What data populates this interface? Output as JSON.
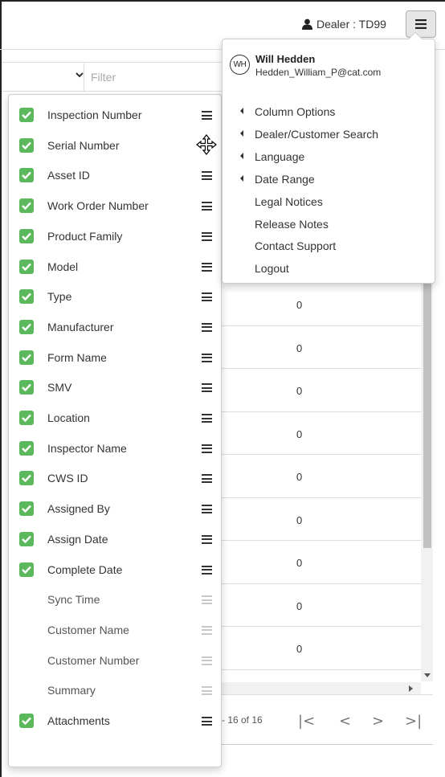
{
  "header": {
    "dealer_label": "Dealer : TD99"
  },
  "filter": {
    "placeholder": "Filter"
  },
  "columns": [
    {
      "label": "Inspection Number",
      "checked": true
    },
    {
      "label": "Serial Number",
      "checked": true
    },
    {
      "label": "Asset ID",
      "checked": true
    },
    {
      "label": "Work Order Number",
      "checked": true
    },
    {
      "label": "Product Family",
      "checked": true
    },
    {
      "label": "Model",
      "checked": true
    },
    {
      "label": "Type",
      "checked": true
    },
    {
      "label": "Manufacturer",
      "checked": true
    },
    {
      "label": "Form Name",
      "checked": true
    },
    {
      "label": "SMV",
      "checked": true
    },
    {
      "label": "Location",
      "checked": true
    },
    {
      "label": "Inspector Name",
      "checked": true
    },
    {
      "label": "CWS ID",
      "checked": true
    },
    {
      "label": "Assigned By",
      "checked": true
    },
    {
      "label": "Assign Date",
      "checked": true
    },
    {
      "label": "Complete Date",
      "checked": true
    },
    {
      "label": "Sync Time",
      "checked": false
    },
    {
      "label": "Customer Name",
      "checked": false
    },
    {
      "label": "Customer Number",
      "checked": false
    },
    {
      "label": "Summary",
      "checked": false
    },
    {
      "label": "Attachments",
      "checked": true
    }
  ],
  "user_menu": {
    "initials": "WH",
    "name": "Will Hedden",
    "email": "Hedden_William_P@cat.com",
    "items": [
      {
        "label": "Column Options",
        "submenu": true
      },
      {
        "label": "Dealer/Customer Search",
        "submenu": true
      },
      {
        "label": "Language",
        "submenu": true
      },
      {
        "label": "Date Range",
        "submenu": true
      },
      {
        "label": "Legal Notices",
        "submenu": false
      },
      {
        "label": "Release Notes",
        "submenu": false
      },
      {
        "label": "Contact Support",
        "submenu": false
      },
      {
        "label": "Logout",
        "submenu": false
      }
    ]
  },
  "grid": {
    "values": [
      "0",
      "0",
      "0",
      "0",
      "0",
      "0",
      "0",
      "0",
      "0"
    ]
  },
  "pager": {
    "info": "- 16 of 16",
    "first": "|<",
    "prev": "<",
    "next": ">",
    "last": ">|"
  },
  "colors": {
    "check_green": "#5cb85c",
    "menu_button_bg": "#e6e6e6"
  }
}
